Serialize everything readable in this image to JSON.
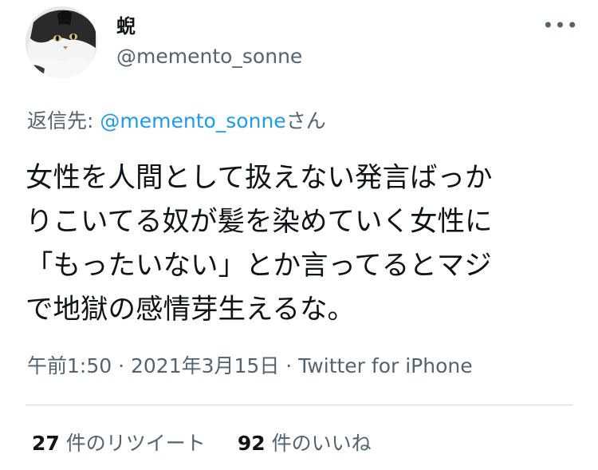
{
  "user": {
    "display_name": "蜺",
    "handle": "@memento_sonne",
    "avatar_icon": "cat-avatar"
  },
  "more_icon": "more-horizontal-icon",
  "more_label": "•••",
  "reply": {
    "prefix": "返信先: ",
    "mention": "@memento_sonne",
    "suffix": "さん"
  },
  "tweet": {
    "lines": [
      "女性を人間として扱えない発言ばっか",
      "りこいてる奴が髪を染めていく女性に",
      "「もったいない」とか言ってるとマジ",
      "で地獄の感情芽生えるな。"
    ]
  },
  "meta": {
    "time": "午前1:50",
    "sep1": " · ",
    "date": "2021年3月15日",
    "sep2": " · ",
    "source": "Twitter for iPhone"
  },
  "stats": {
    "retweets_count": "27",
    "retweets_label": "件のリツイート",
    "likes_count": "92",
    "likes_label": "件のいいね"
  },
  "colors": {
    "text": "#0f1419",
    "secondary": "#536471",
    "link": "#1d9bf0",
    "divider": "#cfd9de"
  }
}
